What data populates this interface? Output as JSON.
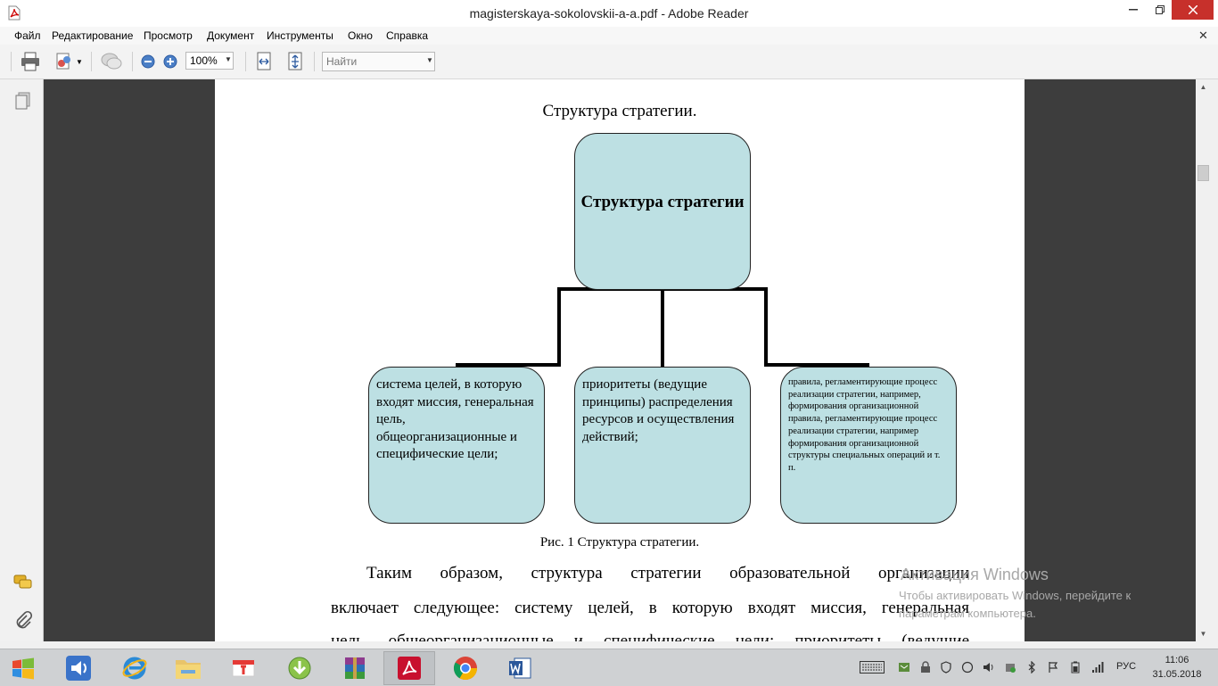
{
  "window": {
    "title": "magisterskaya-sokolovskii-a-a.pdf - Adobe Reader"
  },
  "menu": {
    "items": [
      "Файл",
      "Редактирование",
      "Просмотр",
      "Документ",
      "Инструменты",
      "Окно",
      "Справка"
    ]
  },
  "toolbar": {
    "zoom": "100%",
    "find_placeholder": "Найти"
  },
  "document": {
    "heading": "Структура стратегии.",
    "diagram": {
      "root": "Структура стратегии",
      "children": [
        "система целей, в которую входят миссия, генеральная цель, общеорганизационные и специфические цели;",
        "приоритеты (ведущие принципы) распределения ресурсов и осуществления действий;",
        "правила, регламентирующие процесс реализации стратегии, например, формирования организационной правила, регламентирующие процесс реализации стратегии, например формирования организационной структуры специальных операций и т. п."
      ]
    },
    "figure_caption": "Рис. 1 Структура стратегии.",
    "paragraph_lines": [
      "Таким образом, структура стратегии образовательной организации",
      "включает следующее: систему целей, в которую входят миссия, генеральная",
      "цель, общеорганизационные и специфические цели; приоритеты (ведущие"
    ]
  },
  "activation_notice": {
    "title": "Активация Windows",
    "text": "Чтобы активировать Windows, перейдите к параметрам компьютера."
  },
  "taskbar": {
    "language": "РУС",
    "time": "11:06",
    "date": "31.05.2018"
  },
  "colors": {
    "accent_close": "#c7302b",
    "diagram_fill": "#bde0e3",
    "document_background": "#3d3d3d"
  }
}
